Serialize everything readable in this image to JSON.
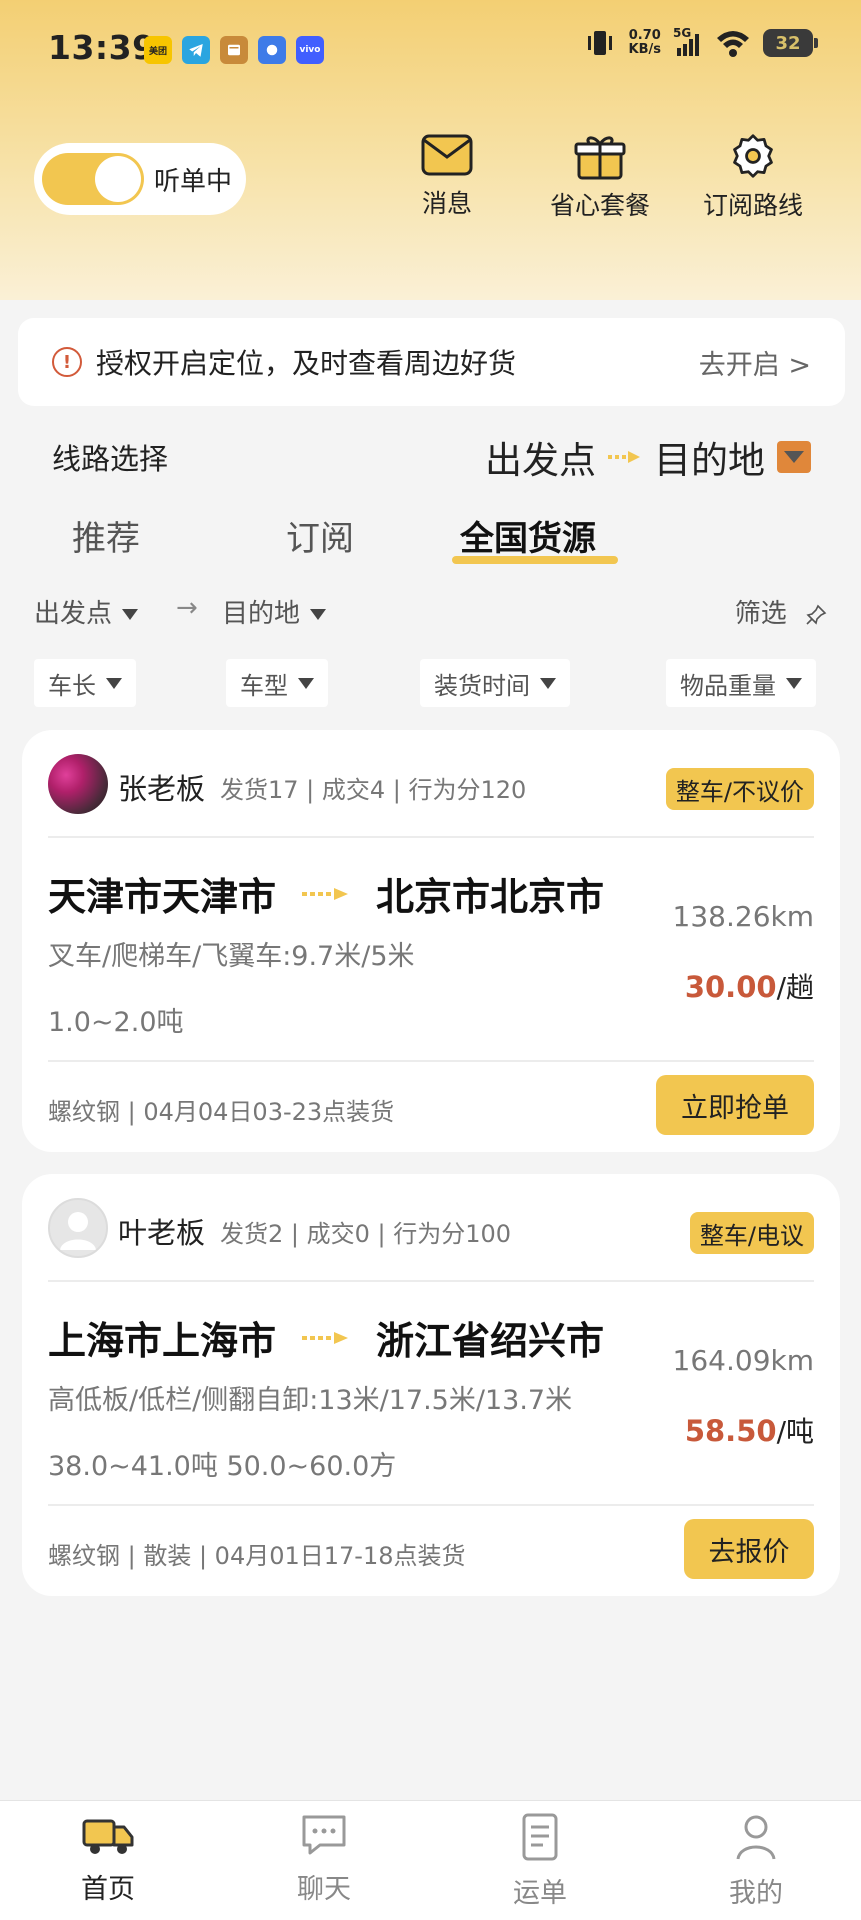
{
  "status_bar": {
    "time": "13:39",
    "apps": [
      {
        "icon": "meituan-icon",
        "label": "美团",
        "color": "#f7c500"
      },
      {
        "icon": "telegram-icon",
        "label": "",
        "color": "#2aa5e0"
      },
      {
        "icon": "news-icon",
        "label": "",
        "color": "#c88a3a"
      },
      {
        "icon": "app-icon",
        "label": "",
        "color": "#3e7be8"
      },
      {
        "icon": "vivo-icon",
        "label": "vivo",
        "color": "#415fff"
      }
    ],
    "net_speed_value": "0.70",
    "net_speed_unit": "KB/s",
    "network": "5G",
    "battery": "32"
  },
  "header": {
    "listen_toggle_label": "听单中",
    "listen_toggle_on": true,
    "actions": [
      {
        "icon": "mail-icon",
        "label": "消息"
      },
      {
        "icon": "gift-icon",
        "label": "省心套餐"
      },
      {
        "icon": "gear-icon",
        "label": "订阅路线"
      }
    ]
  },
  "location_banner": {
    "icon_glyph": "!",
    "text": "授权开启定位，及时查看周边好货",
    "link": "去开启 >"
  },
  "route_select": {
    "label": "线路选择",
    "from": "出发点",
    "to": "目的地"
  },
  "tabs": [
    {
      "label": "推荐",
      "active": false
    },
    {
      "label": "订阅",
      "active": false
    },
    {
      "label": "全国货源",
      "active": true
    }
  ],
  "filters": {
    "from": "出发点",
    "arrow": "→",
    "to": "目的地",
    "screen": "筛选",
    "chips": [
      "车长",
      "车型",
      "装货时间",
      "物品重量"
    ]
  },
  "listings": [
    {
      "owner": "张老板",
      "stats": "发货17 | 成交4 | 行为分120",
      "tag": "整车/不议价",
      "from": "天津市天津市",
      "to": "北京市北京市",
      "vehicle": "叉车/爬梯车/飞翼车:9.7米/5米",
      "weight": "1.0~2.0吨",
      "distance": "138.26km",
      "price": "30.00",
      "price_unit": "/趟",
      "detail": "螺纹钢 | 04月04日03-23点装货",
      "action": "立即抢单"
    },
    {
      "owner": "叶老板",
      "stats": "发货2 | 成交0 | 行为分100",
      "tag": "整车/电议",
      "from": "上海市上海市",
      "to": "浙江省绍兴市",
      "vehicle": "高低板/低栏/侧翻自卸:13米/17.5米/13.7米",
      "weight": "38.0~41.0吨 50.0~60.0方",
      "distance": "164.09km",
      "price": "58.50",
      "price_unit": "/吨",
      "detail": "螺纹钢 | 散装 | 04月01日17-18点装货",
      "action": "去报价"
    }
  ],
  "bottom_nav": [
    {
      "icon": "truck-icon",
      "label": "首页",
      "active": true
    },
    {
      "icon": "chat-icon",
      "label": "聊天",
      "active": false
    },
    {
      "icon": "document-icon",
      "label": "运单",
      "active": false
    },
    {
      "icon": "person-icon",
      "label": "我的",
      "active": false
    }
  ],
  "colors": {
    "accent": "#f2c650",
    "price": "#c8593a",
    "header_gradient_top": "#f3cf73"
  }
}
